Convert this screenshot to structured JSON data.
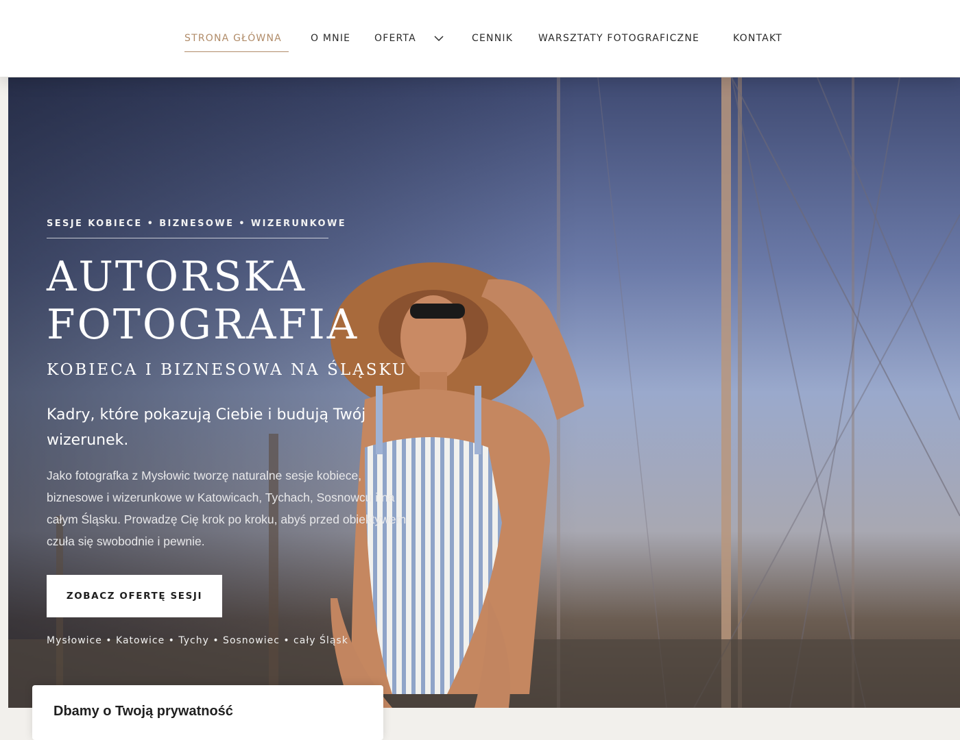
{
  "nav": {
    "items": [
      {
        "label": "STRONA GŁÓWNA",
        "active": true
      },
      {
        "label": "O MNIE",
        "active": false
      },
      {
        "label": "OFERTA",
        "active": false,
        "has_dropdown": true
      },
      {
        "label": "CENNIK",
        "active": false
      },
      {
        "label": "WARSZTATY FOTOGRAFICZNE",
        "active": false
      },
      {
        "label": "KONTAKT",
        "active": false
      }
    ]
  },
  "hero": {
    "tagline": "SESJE KOBIECE • BIZNESOWE • WIZERUNKOWE",
    "headline_line1": "AUTORSKA",
    "headline_line2": "FOTOGRAFIA",
    "subheadline": "KOBIECA I BIZNESOWA NA ŚLĄSKU",
    "lead": "Kadry, które pokazują Ciebie i budują Twój wizerunek.",
    "body": "Jako fotografka z Mysłowic tworzę naturalne sesje kobiece, biznesowe i wizerunkowe w Katowicach, Tychach, Sosnowcu i na całym Śląsku. Prowadzę Cię krok po kroku, abyś przed obiektywem czuła się swobodnie i pewnie.",
    "cta_label": "ZOBACZ OFERTĘ SESJI",
    "locations": "Mysłowice • Katowice • Tychy • Sosnowiec • cały Śląsk"
  },
  "cookie": {
    "title": "Dbamy o Twoją prywatność"
  },
  "colors": {
    "accent": "#b08b68",
    "nav_text": "#2a2a2a",
    "hero_text": "#ffffff"
  },
  "icons": {
    "dropdown": "chevron-down-icon"
  }
}
